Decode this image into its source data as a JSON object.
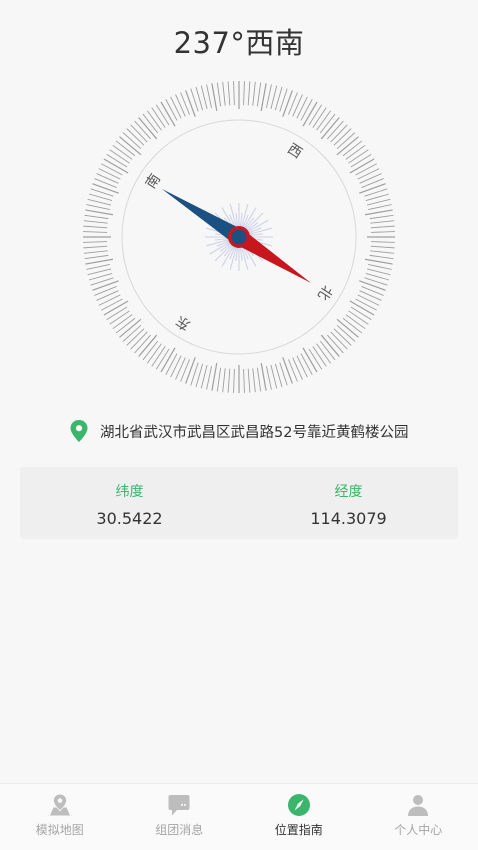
{
  "heading": {
    "title": "237°西南"
  },
  "compass": {
    "heading_degrees": 237,
    "direction_labels": {
      "north": "北",
      "east": "东",
      "south": "南",
      "west": "西"
    },
    "colors": {
      "needle_red": "#c8161d",
      "needle_blue": "#1c4f82",
      "ticks": "#9e9e9e",
      "ring": "#d6d6d6"
    }
  },
  "location": {
    "icon": "map-pin-icon",
    "address": "湖北省武汉市武昌区武昌路52号靠近黄鹤楼公园"
  },
  "coordinates": {
    "latitude_label": "纬度",
    "latitude_value": "30.5422",
    "longitude_label": "经度",
    "longitude_value": "114.3079"
  },
  "tabbar": {
    "active_tab": "位置指南",
    "accent_color": "#3bb56c",
    "items": [
      {
        "label": "模拟地图",
        "icon": "map-icon"
      },
      {
        "label": "组团消息",
        "icon": "chat-icon"
      },
      {
        "label": "位置指南",
        "icon": "compass-icon"
      },
      {
        "label": "个人中心",
        "icon": "person-icon"
      }
    ]
  }
}
